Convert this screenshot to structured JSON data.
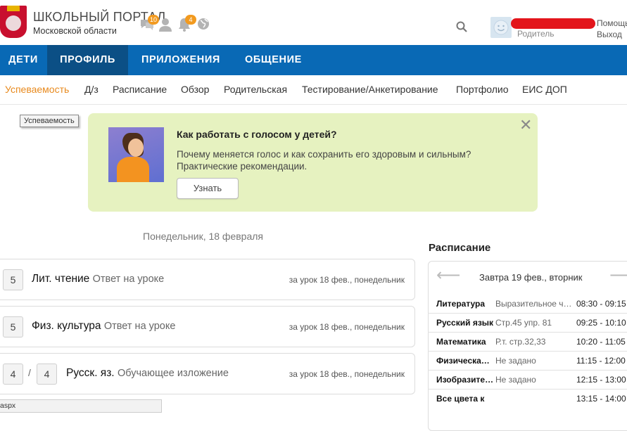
{
  "brand": {
    "title": "ШКОЛЬНЫЙ ПОРТАЛ",
    "subtitle": "Московской области"
  },
  "header": {
    "messages_badge": "10",
    "notifications_badge": "4",
    "user_role": "Родитель",
    "help_label": "Помощь",
    "logout_label": "Выход"
  },
  "colors": {
    "nav_bg": "#0969b5",
    "nav_active": "#0b4f85",
    "accent_orange": "#e88a1e",
    "banner_bg": "#e6f2c0",
    "redaction": "#e3151b"
  },
  "nav": {
    "items": [
      {
        "label": "ДЕТИ"
      },
      {
        "label": "ПРОФИЛЬ"
      },
      {
        "label": "ПРИЛОЖЕНИЯ"
      },
      {
        "label": "ОБЩЕНИЕ"
      }
    ],
    "active": "ПРОФИЛЬ"
  },
  "subnav": {
    "items": [
      {
        "label": "Успеваемость"
      },
      {
        "label": "Д/з"
      },
      {
        "label": "Расписание"
      },
      {
        "label": "Обзор"
      },
      {
        "label": "Родительская"
      },
      {
        "label": "Тестирование/Анкетирование"
      },
      {
        "label": "Портфолио"
      },
      {
        "label": "ЕИС ДОП"
      }
    ],
    "active": "Успеваемость"
  },
  "tooltip": "Успеваемость",
  "banner": {
    "title": "Как работать с голосом у детей?",
    "text": "Почему меняется голос и как сохранить его здоровым и сильным? Практические рекомендации.",
    "button_label": "Узнать",
    "close_glyph": "✕"
  },
  "feed": {
    "date_label": "Понедельник, 18 февраля",
    "cards": [
      {
        "grades": [
          "5"
        ],
        "subject": "Лит. чтение",
        "kind": "Ответ на уроке",
        "when": "за урок 18 фев., понедельник"
      },
      {
        "grades": [
          "5"
        ],
        "subject": "Физ. культура",
        "kind": "Ответ на уроке",
        "when": "за урок 18 фев., понедельник"
      },
      {
        "grades": [
          "4",
          "4"
        ],
        "separator": "/",
        "subject": "Русск. яз.",
        "kind": "Обучающее изложение",
        "when": "за урок 18 фев., понедельник"
      }
    ]
  },
  "schedule": {
    "title": "Расписание",
    "day_label": "Завтра 19 фев., вторник",
    "rows": [
      {
        "subject": "Литература",
        "homework": "Выразительное чтение",
        "time": "08:30 - 09:15"
      },
      {
        "subject": "Русский язык",
        "homework": "Стр.45 упр. 81",
        "time": "09:25 - 10:10"
      },
      {
        "subject": "Математика",
        "homework": "Р.т. стр.32,33",
        "time": "10:20 - 11:05"
      },
      {
        "subject": "Физическая культура",
        "homework": "Не задано",
        "time": "11:15 - 12:00"
      },
      {
        "subject": "Изобразительное искусство",
        "homework": "Не задано",
        "time": "12:15 - 13:00"
      },
      {
        "subject": "Все цвета к",
        "homework": "",
        "time": "13:15 - 14:00"
      }
    ]
  },
  "statusbar": "aspx"
}
